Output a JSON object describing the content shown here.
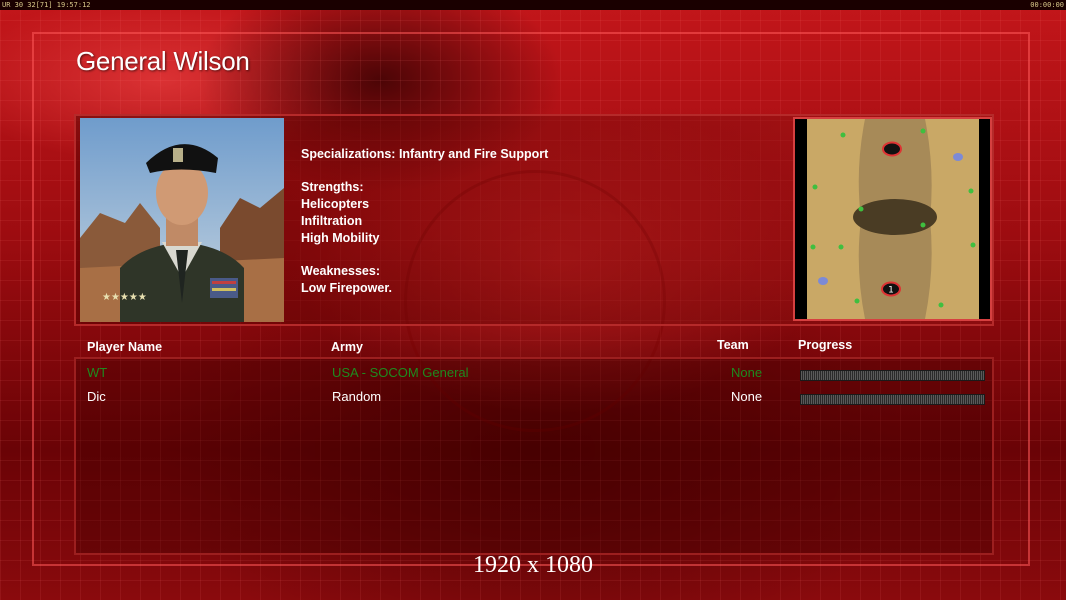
{
  "hud": {
    "left": "UR 30 32[71] 19:57:12",
    "right": "00:00:00"
  },
  "general": {
    "title": "General Wilson",
    "specializations": "Specializations: Infantry and Fire Support",
    "strengths_heading": "Strengths:",
    "strengths": [
      "Helicopters",
      "Infiltration",
      "High Mobility"
    ],
    "weaknesses_heading": "Weaknesses:",
    "weaknesses": [
      "Low Firepower."
    ]
  },
  "minimap": {
    "start_positions": [
      "",
      "1"
    ]
  },
  "table": {
    "headers": {
      "player_name": "Player Name",
      "army": "Army",
      "team": "Team",
      "progress": "Progress"
    },
    "rows": [
      {
        "name": "WT",
        "army": "USA - SOCOM General",
        "team": "None",
        "progress": 0,
        "color": "#1e8a1e"
      },
      {
        "name": "Dic",
        "army": "Random",
        "team": "None",
        "progress": 0,
        "color": "#ffffff"
      }
    ]
  },
  "resolution_label": "1920 x 1080",
  "colors": {
    "panel_border": "#b52a2a",
    "local_player": "#1e8a1e",
    "text": "#ffffff"
  }
}
